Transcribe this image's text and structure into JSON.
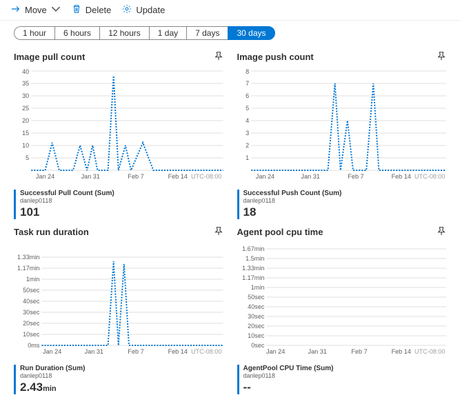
{
  "toolbar": {
    "move": "Move",
    "delete": "Delete",
    "update": "Update"
  },
  "time_tabs": [
    "1 hour",
    "6 hours",
    "12 hours",
    "1 day",
    "7 days",
    "30 days"
  ],
  "time_tab_active": 5,
  "x_ticks": [
    "Jan 24",
    "Jan 31",
    "Feb 7",
    "Feb 14"
  ],
  "tz": "UTC-08:00",
  "charts": [
    {
      "title": "Image pull count",
      "y_ticks": [
        "5",
        "10",
        "15",
        "20",
        "25",
        "30",
        "35",
        "40"
      ],
      "legend_title": "Successful Pull Count (Sum)",
      "legend_sub": "danlep0118",
      "legend_value": "101",
      "legend_unit": ""
    },
    {
      "title": "Image push count",
      "y_ticks": [
        "1",
        "2",
        "3",
        "4",
        "5",
        "6",
        "7",
        "8"
      ],
      "legend_title": "Successful Push Count (Sum)",
      "legend_sub": "danlep0118",
      "legend_value": "18",
      "legend_unit": ""
    },
    {
      "title": "Task run duration",
      "y_ticks": [
        "0ms",
        "10sec",
        "20sec",
        "30sec",
        "40sec",
        "50sec",
        "1min",
        "1.17min",
        "1.33min"
      ],
      "legend_title": "Run Duration (Sum)",
      "legend_sub": "danlep0118",
      "legend_value": "2.43",
      "legend_unit": "min"
    },
    {
      "title": "Agent pool cpu time",
      "y_ticks": [
        "0sec",
        "10sec",
        "20sec",
        "30sec",
        "40sec",
        "50sec",
        "1min",
        "1.17min",
        "1.33min",
        "1.5min",
        "1.67min"
      ],
      "legend_title": "AgentPool CPU Time (Sum)",
      "legend_sub": "danlep0118",
      "legend_value": "--",
      "legend_unit": ""
    }
  ],
  "chart_data": [
    {
      "type": "line",
      "title": "Image pull count",
      "xlabel": "",
      "ylabel": "",
      "ylim": [
        0,
        40
      ],
      "x_categories": [
        "Jan 24",
        "Jan 31",
        "Feb 7",
        "Feb 14"
      ],
      "series": [
        {
          "name": "Successful Pull Count (Sum)",
          "points": [
            {
              "x": "Jan 22",
              "y": 0
            },
            {
              "x": "Jan 24",
              "y": 11
            },
            {
              "x": "Jan 26",
              "y": 0
            },
            {
              "x": "Jan 28",
              "y": 10
            },
            {
              "x": "Jan 30",
              "y": 0
            },
            {
              "x": "Jan 31",
              "y": 10
            },
            {
              "x": "Feb 2",
              "y": 0
            },
            {
              "x": "Feb 3",
              "y": 38
            },
            {
              "x": "Feb 4",
              "y": 0
            },
            {
              "x": "Feb 5",
              "y": 10
            },
            {
              "x": "Feb 6",
              "y": 0
            },
            {
              "x": "Feb 8",
              "y": 11
            },
            {
              "x": "Feb 10",
              "y": 0
            },
            {
              "x": "Feb 18",
              "y": 0
            }
          ]
        }
      ]
    },
    {
      "type": "line",
      "title": "Image push count",
      "xlabel": "",
      "ylabel": "",
      "ylim": [
        0,
        8
      ],
      "x_categories": [
        "Jan 24",
        "Jan 31",
        "Feb 7",
        "Feb 14"
      ],
      "series": [
        {
          "name": "Successful Push Count (Sum)",
          "points": [
            {
              "x": "Jan 22",
              "y": 0
            },
            {
              "x": "Feb 2",
              "y": 0
            },
            {
              "x": "Feb 3",
              "y": 7
            },
            {
              "x": "Feb 4",
              "y": 0
            },
            {
              "x": "Feb 5",
              "y": 4
            },
            {
              "x": "Feb 6",
              "y": 0
            },
            {
              "x": "Feb 8",
              "y": 7
            },
            {
              "x": "Feb 9",
              "y": 0
            },
            {
              "x": "Feb 18",
              "y": 0
            }
          ]
        }
      ]
    },
    {
      "type": "line",
      "title": "Task run duration",
      "xlabel": "",
      "ylabel": "",
      "ylim": [
        0,
        80
      ],
      "y_unit": "sec",
      "x_categories": [
        "Jan 24",
        "Jan 31",
        "Feb 7",
        "Feb 14"
      ],
      "series": [
        {
          "name": "Run Duration (Sum)",
          "points": [
            {
              "x": "Jan 22",
              "y": 0
            },
            {
              "x": "Feb 2",
              "y": 0
            },
            {
              "x": "Feb 3",
              "y": 75
            },
            {
              "x": "Feb 4",
              "y": 0
            },
            {
              "x": "Feb 5",
              "y": 72
            },
            {
              "x": "Feb 6",
              "y": 0
            },
            {
              "x": "Feb 18",
              "y": 0
            }
          ]
        }
      ]
    },
    {
      "type": "line",
      "title": "Agent pool cpu time",
      "xlabel": "",
      "ylabel": "",
      "ylim": [
        0,
        100
      ],
      "y_unit": "sec",
      "x_categories": [
        "Jan 24",
        "Jan 31",
        "Feb 7",
        "Feb 14"
      ],
      "series": [
        {
          "name": "AgentPool CPU Time (Sum)",
          "points": []
        }
      ]
    }
  ]
}
